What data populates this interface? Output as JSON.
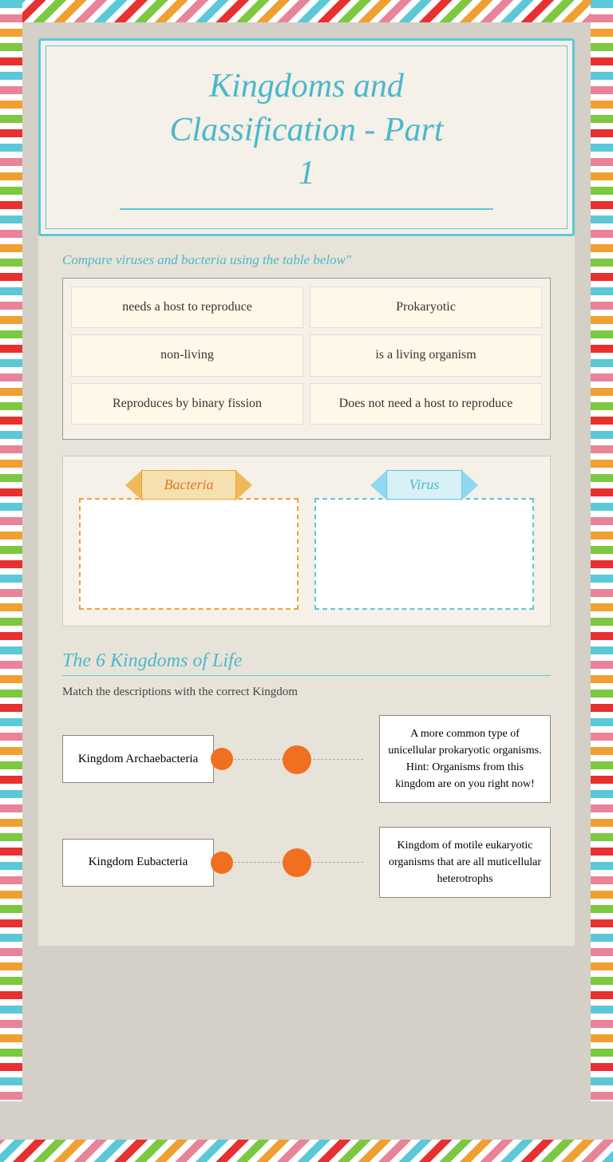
{
  "page": {
    "title": "Kingdoms and Classification - Part 1"
  },
  "header": {
    "title_line1": "Kingdoms and",
    "title_line2": "Classification - Part",
    "title_line3": "1"
  },
  "compare": {
    "section_title": "Compare viruses and bacteria using the table below\"",
    "cells": [
      [
        "needs a host to reproduce",
        "Prokaryotic"
      ],
      [
        "non-living",
        "is a living organism"
      ],
      [
        "Reproduces by binary fission",
        "Does not need a host to reproduce"
      ]
    ]
  },
  "drag_drop": {
    "bacteria_label": "Bacteria",
    "virus_label": "Virus"
  },
  "kingdoms": {
    "section_title": "The 6 Kingdoms of Life",
    "subtitle": "Match the descriptions with the correct Kingdom",
    "items": [
      {
        "kingdom": "Kingdom Archaebacteria",
        "description": "A more common type of unicellular prokaryotic organisms. Hint: Organisms from this kingdom are on you right now!"
      },
      {
        "kingdom": "Kingdom Eubacteria",
        "description": "Kingdom of motile eukaryotic organisms that are all muticellular heterotrophs"
      }
    ]
  }
}
